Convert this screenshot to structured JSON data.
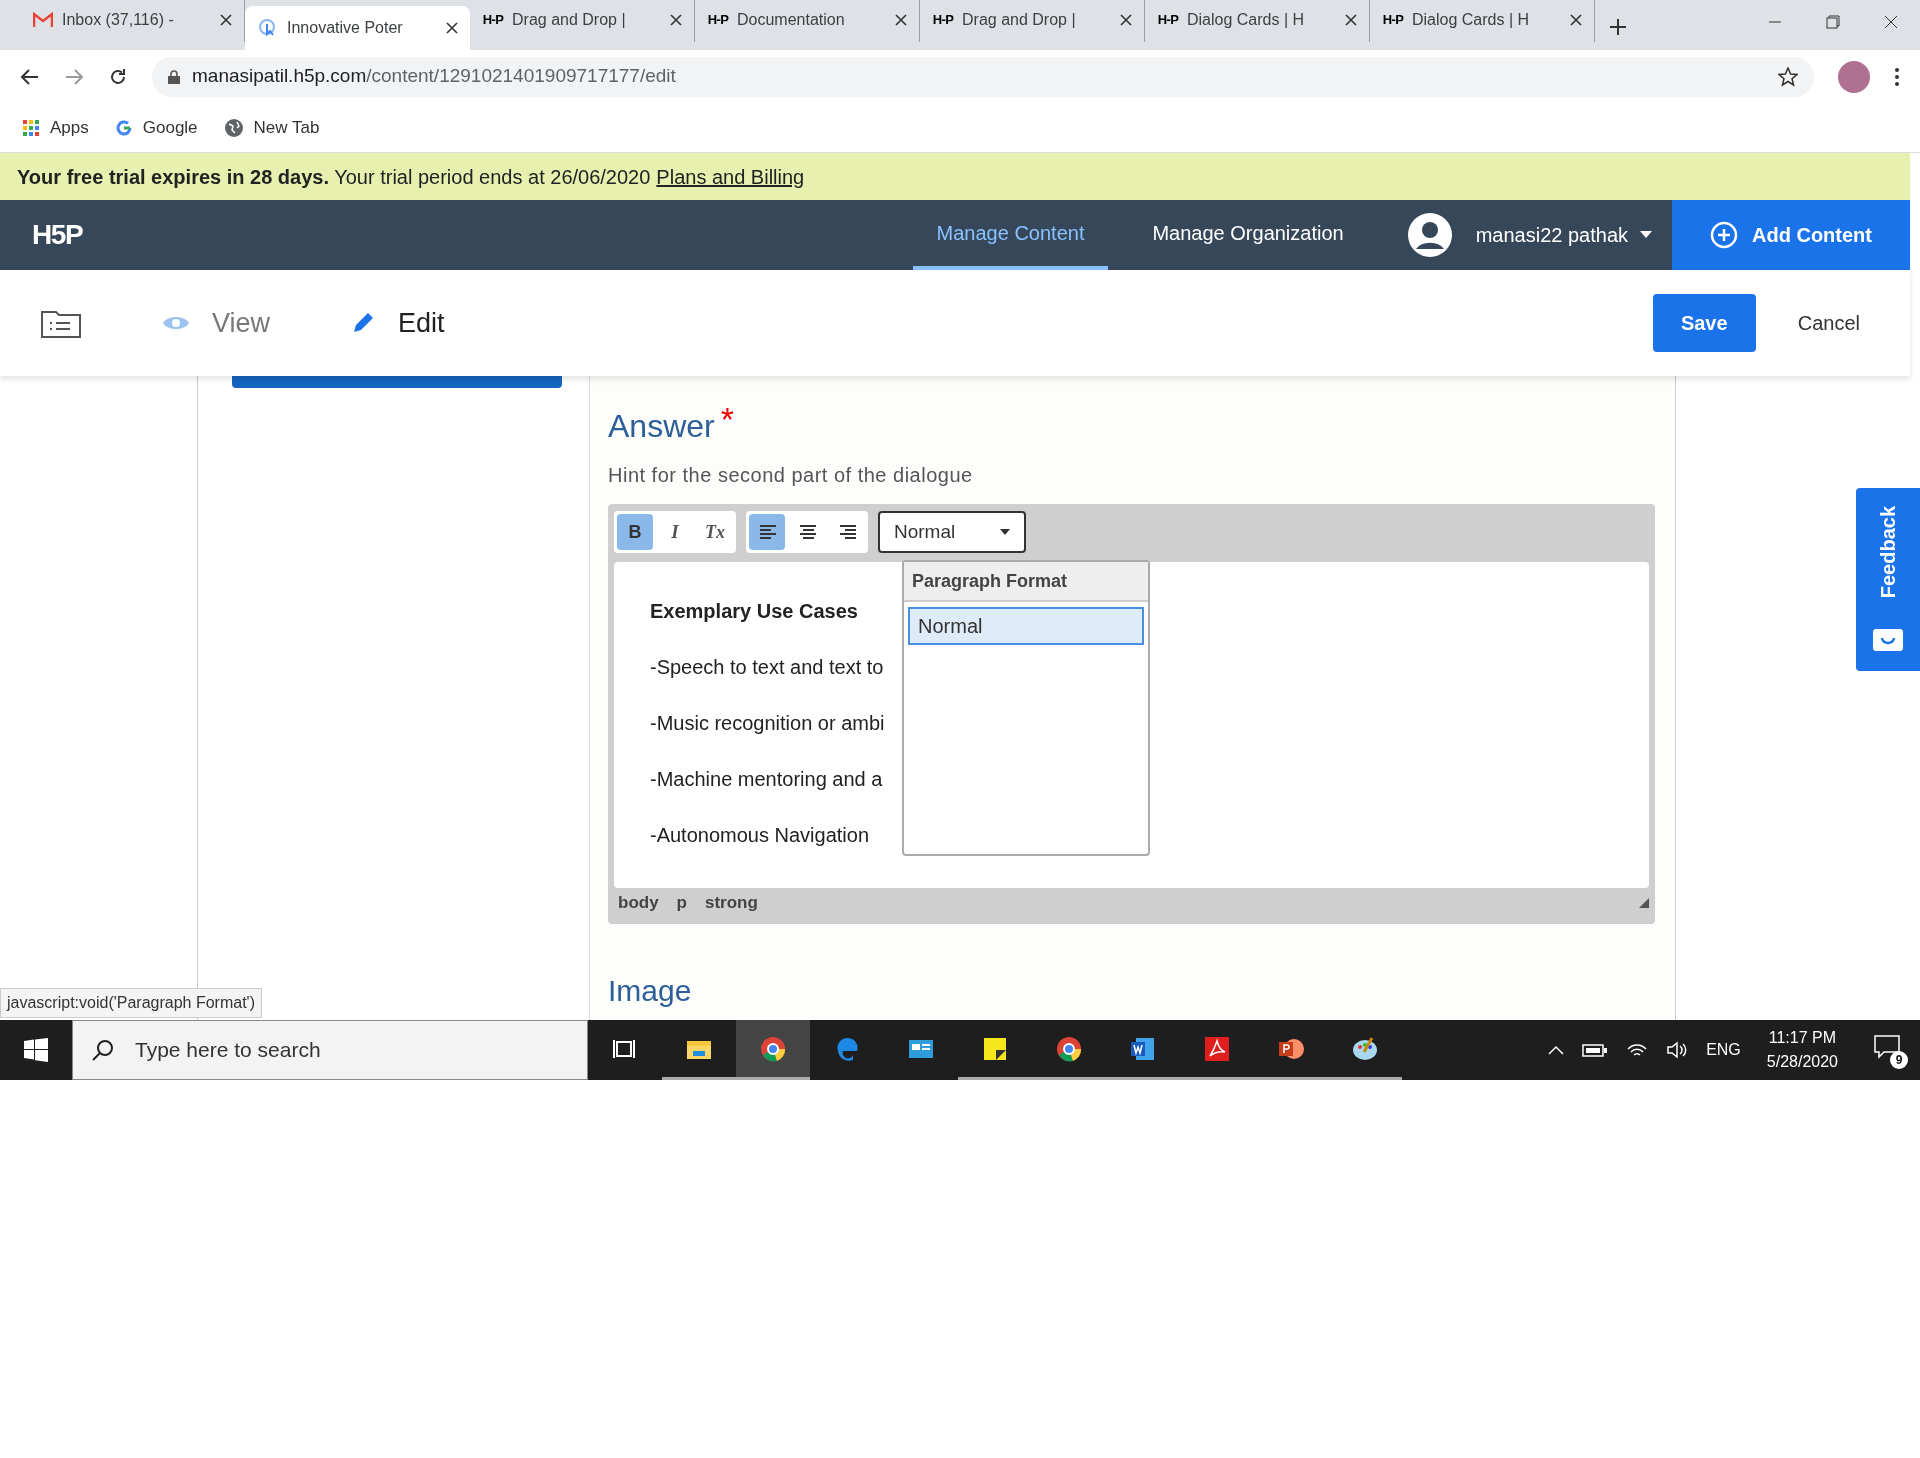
{
  "browser_tabs": [
    {
      "kind": "gmail",
      "title": "Inbox (37,116) -",
      "selected": false
    },
    {
      "kind": "web",
      "title": "Innovative Poter",
      "selected": true
    },
    {
      "kind": "h5p",
      "badge": "H-P",
      "title": "Drag and Drop |",
      "selected": false
    },
    {
      "kind": "h5p",
      "badge": "H-P",
      "title": "Documentation",
      "selected": false
    },
    {
      "kind": "h5p",
      "badge": "H-P",
      "title": "Drag and Drop |",
      "selected": false
    },
    {
      "kind": "h5p",
      "badge": "H-P",
      "title": "Dialog Cards | H",
      "selected": false
    },
    {
      "kind": "h5p",
      "badge": "H-P",
      "title": "Dialog Cards | H",
      "selected": false
    }
  ],
  "address": {
    "host": "manasipatil.h5p.com",
    "path": "/content/1291021401909717177/edit"
  },
  "bookmarks": [
    {
      "kind": "apps",
      "label": "Apps"
    },
    {
      "kind": "google",
      "label": "Google"
    },
    {
      "kind": "globe",
      "label": "New Tab"
    }
  ],
  "trial_banner": {
    "text": "**Your free trial expires in 28 days.** Your trial period ends at 26/06/2020",
    "link": "Plans and Billing"
  },
  "nav": {
    "logo": "H5P",
    "items": [
      {
        "label": "Manage Content",
        "selected": true
      },
      {
        "label": "Manage Organization",
        "selected": false
      }
    ],
    "user": "manasi22 pathak",
    "add_button": "Add Content"
  },
  "mode_tabs": [
    {
      "label": "View",
      "selected": false
    },
    {
      "label": "Edit",
      "selected": true
    }
  ],
  "actions": {
    "save": "Save",
    "cancel": "Cancel"
  },
  "field": {
    "label": "Answer",
    "required_mark": "*",
    "hint": "Hint for the second part of the dialogue"
  },
  "editor": {
    "buttons": [
      {
        "kind": "bold",
        "label": "B",
        "on": true
      },
      {
        "kind": "italic",
        "label": "I",
        "on": false
      },
      {
        "kind": "clear",
        "label": "Tx",
        "on": false
      },
      {
        "kind": "align-left",
        "on": true
      },
      {
        "kind": "align-center",
        "on": false
      },
      {
        "kind": "align-right",
        "on": false
      }
    ],
    "format_select": "Normal",
    "content": [
      {
        "text": "Exemplary Use Cases",
        "bold": true
      },
      {
        "text": "-Speech to text and text to",
        "bold": false
      },
      {
        "text": "-Music recognition or ambi",
        "bold": false
      },
      {
        "text": "-Machine mentoring and a",
        "bold": false
      },
      {
        "text": "-Autonomous Navigation",
        "bold": false
      }
    ],
    "path": [
      "body",
      "p",
      "strong"
    ],
    "dropdown": {
      "title": "Paragraph Format",
      "options": [
        {
          "label": "Normal",
          "selected": true
        }
      ]
    }
  },
  "next_field": {
    "label": "Image"
  },
  "feedback": "Feedback",
  "status_link": "javascript:void('Paragraph Format')",
  "taskbar": {
    "search_placeholder": "Type here to search",
    "apps": [
      {
        "kind": "taskview",
        "running": false
      },
      {
        "kind": "explorer",
        "running": true
      },
      {
        "kind": "chrome",
        "running": true
      },
      {
        "kind": "edge",
        "running": false
      },
      {
        "kind": "calc",
        "running": false
      },
      {
        "kind": "notes",
        "running": true
      },
      {
        "kind": "chrome2",
        "running": true
      },
      {
        "kind": "word",
        "running": true
      },
      {
        "kind": "acrobat",
        "running": true
      },
      {
        "kind": "powerpoint",
        "running": true
      },
      {
        "kind": "paint",
        "running": true
      }
    ],
    "language": "ENG",
    "time": "11:17 PM",
    "date": "5/28/2020",
    "notifications": "9"
  }
}
